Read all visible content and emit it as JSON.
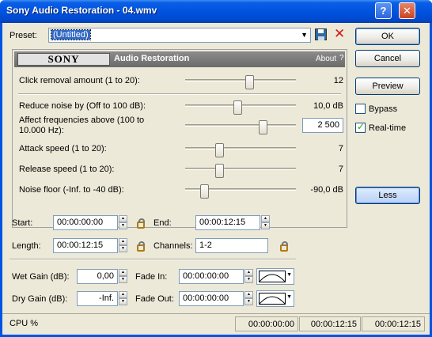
{
  "window": {
    "title": "Sony Audio Restoration - 04.wmv"
  },
  "titlebar_buttons": {
    "help": "?",
    "close": "✕"
  },
  "preset": {
    "label": "Preset:",
    "value": "(Untitled)"
  },
  "buttons": {
    "ok": "OK",
    "cancel": "Cancel",
    "preview": "Preview",
    "less": "Less"
  },
  "checkboxes": {
    "bypass": {
      "label": "Bypass",
      "checked": false
    },
    "realtime": {
      "label": "Real-time",
      "checked": true
    }
  },
  "plugin": {
    "brand": "SONY",
    "name": "Audio Restoration",
    "about": "About",
    "help": "?"
  },
  "params": {
    "click_removal": {
      "label": "Click removal amount (1 to 20):",
      "value": "12",
      "level": 0.58
    },
    "reduce_noise": {
      "label": "Reduce noise by (Off to 100 dB):",
      "value": "10,0 dB",
      "level": 0.47
    },
    "affect_freq": {
      "label": "Affect frequencies above (100 to 10.000 Hz):",
      "value": "2 500",
      "level": 0.7
    },
    "attack": {
      "label": "Attack speed (1 to 20):",
      "value": "7",
      "level": 0.31
    },
    "release": {
      "label": "Release speed (1 to 20):",
      "value": "7",
      "level": 0.31
    },
    "noise_floor": {
      "label": "Noise floor (-Inf. to -40 dB):",
      "value": "-90,0 dB",
      "level": 0.17
    }
  },
  "range": {
    "start_label": "Start:",
    "start": "00:00:00:00",
    "end_label": "End:",
    "end": "00:00:12:15",
    "length_label": "Length:",
    "length": "00:00:12:15",
    "channels_label": "Channels:",
    "channels": "1-2"
  },
  "gain": {
    "wet_label": "Wet Gain (dB):",
    "wet": "0,00",
    "dry_label": "Dry Gain (dB):",
    "dry": "-Inf.",
    "fade_in_label": "Fade In:",
    "fade_in": "00:00:00:00",
    "fade_out_label": "Fade Out:",
    "fade_out": "00:00:00:00"
  },
  "status": {
    "cpu": "CPU %",
    "pos1": "00:00:00:00",
    "pos2": "00:00:12:15",
    "pos3": "00:00:12:15"
  }
}
